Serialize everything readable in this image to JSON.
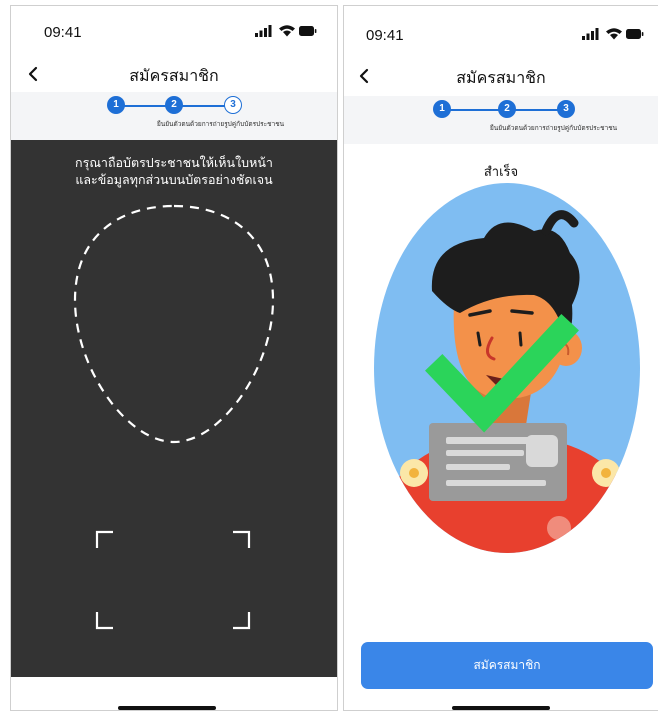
{
  "status": {
    "time": "09:41"
  },
  "nav": {
    "title": "สมัครสมาชิก"
  },
  "stepper": {
    "steps": [
      "1",
      "2",
      "3"
    ],
    "caption": "ยืนยันตัวตนด้วยการถ่ายรูปคู่กับบัตรประชาชน",
    "left_active_count": 2,
    "right_active_count": 3,
    "active_color": "#1e6fd6"
  },
  "left_screen": {
    "instruction_line1": "กรุณาถือบัตรประชาชนให้เห็นใบหน้า",
    "instruction_line2": "และข้อมูลทุกส่วนบนบัตรอย่างชัดเจน"
  },
  "right_screen": {
    "success_label": "สำเร็จ",
    "register_button": "สมัครสมาชิก"
  },
  "colors": {
    "camera_bg": "#333333",
    "button_bg": "#3a86e8",
    "check_green": "#2bd45a",
    "oval_sky": "#7fbdf2"
  },
  "icons": [
    "back-icon",
    "signal-icon",
    "wifi-icon",
    "battery-icon",
    "face-guide-icon",
    "card-frame-icon",
    "checkmark-icon",
    "id-card-icon"
  ]
}
